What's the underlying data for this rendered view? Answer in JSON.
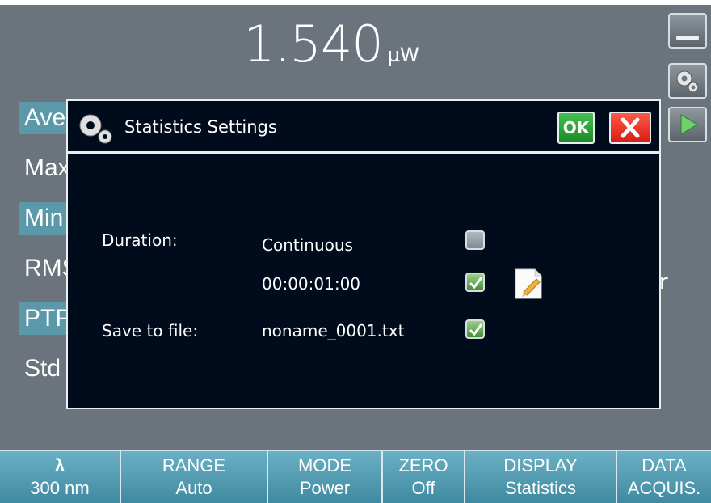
{
  "reading": {
    "value": "1.540",
    "unit": "µW"
  },
  "side_buttons": [
    "minimize-icon",
    "settings-gears-icon",
    "play-icon"
  ],
  "stat_rows": [
    {
      "label": "Ave",
      "highlight": true
    },
    {
      "label": "Max",
      "highlight": false
    },
    {
      "label": "Min",
      "highlight": true
    },
    {
      "label": "RMS",
      "highlight": false
    },
    {
      "label": "PTP",
      "highlight": true
    },
    {
      "label": "Std",
      "highlight": false
    }
  ],
  "stray_char": "r",
  "dialog": {
    "title": "Statistics Settings",
    "ok_label": "OK",
    "duration_label": "Duration:",
    "continuous_text": "Continuous",
    "continuous_checked": false,
    "time_value": "00:00:01:00",
    "time_checked": true,
    "save_label": "Save to file:",
    "filename": "noname_0001.txt",
    "save_checked": true
  },
  "bottom_bar": [
    {
      "title": "λ",
      "value": "300 nm"
    },
    {
      "title": "RANGE",
      "value": "Auto"
    },
    {
      "title": "MODE",
      "value": "Power"
    },
    {
      "title": "ZERO",
      "value": "Off"
    },
    {
      "title": "DISPLAY",
      "value": "Statistics"
    },
    {
      "title": "DATA",
      "value": "ACQUIS."
    }
  ],
  "colors": {
    "highlight": "#5b98aa",
    "dialog_bg": "#000c1c",
    "bar": "#4f9bb2",
    "ok_green": "#2aa335",
    "cancel_red": "#e8281c"
  }
}
